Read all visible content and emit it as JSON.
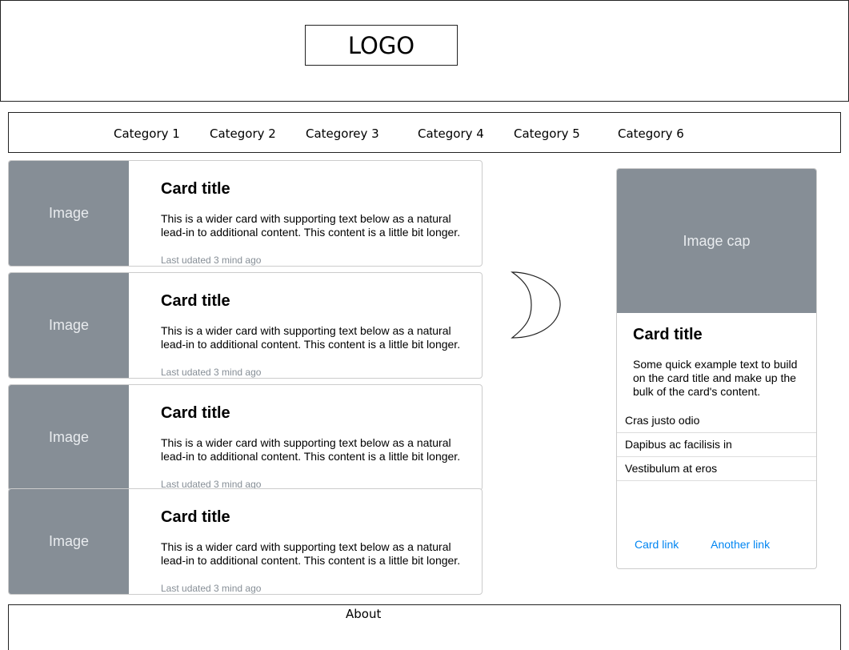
{
  "header": {
    "logo": "LOGO"
  },
  "nav": {
    "items": [
      "Category 1",
      "Category 2",
      "Categorey 3",
      "Category 4",
      "Category 5",
      "Category 6"
    ]
  },
  "cards": [
    {
      "image": "Image",
      "title": "Card title",
      "text": "This is a wider card with supporting text below as a natural lead-in to additional content. This content is a little bit longer.",
      "meta": "Last udated 3 mind ago"
    },
    {
      "image": "Image",
      "title": "Card title",
      "text": "This is a wider card with supporting text below as a natural lead-in to additional content. This content is a little bit longer.",
      "meta": "Last udated 3 mind ago"
    },
    {
      "image": "Image",
      "title": "Card title",
      "text": "This is a wider card with supporting text below as a natural lead-in to additional content. This content is a little bit longer.",
      "meta": "Last udated 3 mind ago"
    },
    {
      "image": "Image",
      "title": "Card title",
      "text": "This is a wider card with supporting text below as a natural lead-in to additional content. This content is a little bit longer.",
      "meta": "Last udated 3 mind ago"
    }
  ],
  "side_card": {
    "image": "Image cap",
    "title": "Card title",
    "text": "Some quick example text to build on the card title and make up the bulk of the card's content.",
    "list": [
      "Cras justo odio",
      "Dapibus ac facilisis in",
      "Vestibulum at eros"
    ],
    "link1": "Card link",
    "link2": "Another link"
  },
  "footer": {
    "about": "About"
  },
  "colors": {
    "image_bg": "#868e96",
    "link": "#0085f2",
    "meta": "#868e96"
  }
}
